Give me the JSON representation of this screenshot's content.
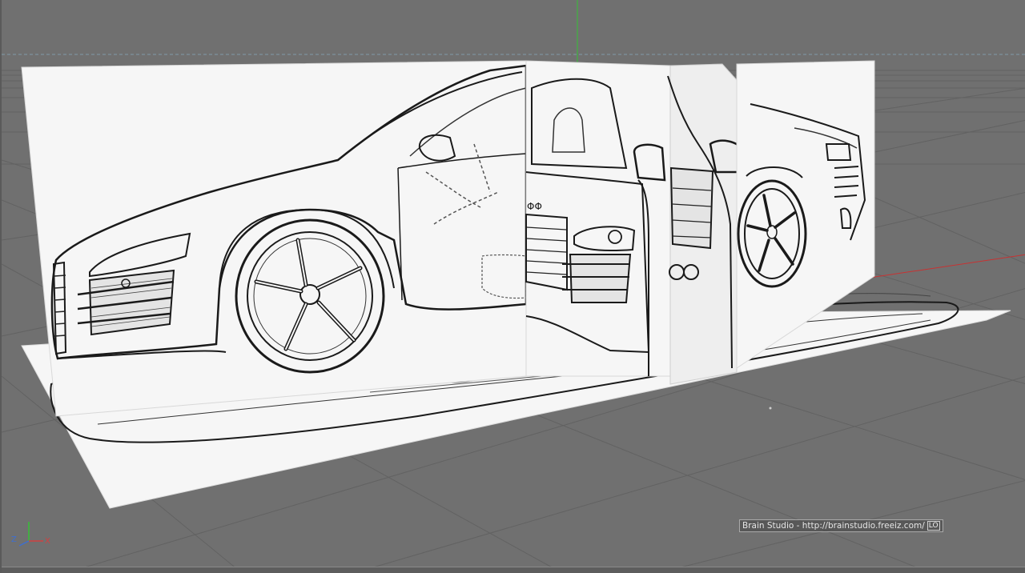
{
  "viewport": {
    "name": "3D perspective viewport",
    "background_color": "#707070",
    "floor_grid_color": "#5e5e5e",
    "horizon_line_color": "#7f9aa8",
    "y_axis_color": "#36c036",
    "x_axis_color": "#c83232"
  },
  "scene": {
    "planes": [
      "side-view blueprint plane",
      "front-view blueprint plane",
      "rear-view blueprint plane",
      "top-view blueprint plane"
    ],
    "blueprint_paper_color": "#f6f6f6",
    "blueprint_line_color": "#1a1a1a"
  },
  "axis_gizmo": {
    "z_label": "Z",
    "x_label": "X"
  },
  "watermark": {
    "text": "Brain Studio - http://brainstudio.freeiz.com/",
    "badge": "LO"
  }
}
